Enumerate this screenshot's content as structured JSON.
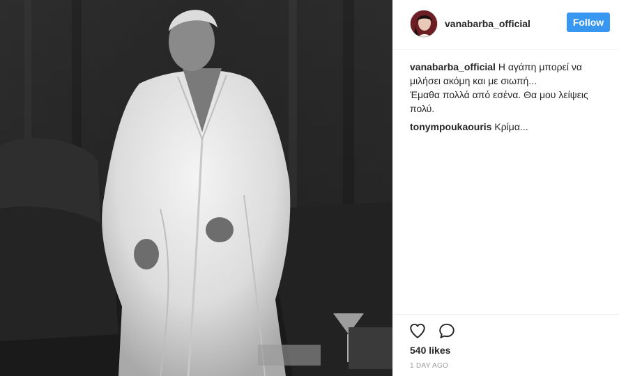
{
  "post": {
    "username": "vanabarba_official",
    "follow_label": "Follow",
    "caption": {
      "user": "vanabarba_official",
      "text": "Η αγάπη μπορεί να μιλήσει ακόμη και με σιωπή...\nΈμαθα πολλά από εσένα. Θα μου λείψεις πολύ."
    },
    "comments": [
      {
        "user": "tonympoukaouris",
        "text": "Κρίμα..."
      }
    ],
    "likes": "540 likes",
    "time": "1 DAY AGO"
  },
  "icons": {
    "like": "heart-icon",
    "comment": "comment-bubble-icon"
  },
  "colors": {
    "follow_button": "#3897f0",
    "border": "#efefef",
    "muted_text": "#999999"
  }
}
